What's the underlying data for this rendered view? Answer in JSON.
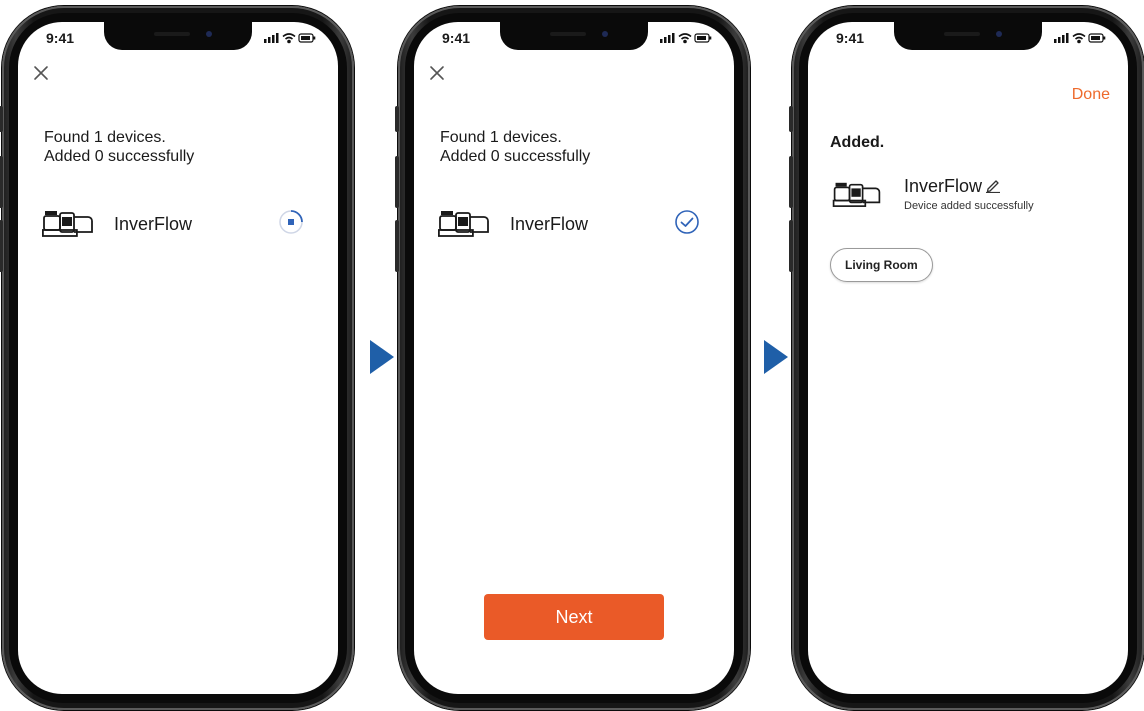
{
  "status_bar": {
    "time": "9:41"
  },
  "screen1": {
    "found_line1": "Found 1 devices.",
    "found_line2": "Added 0 successfully",
    "device_name": "InverFlow",
    "state": "adding"
  },
  "screen2": {
    "found_line1": "Found 1 devices.",
    "found_line2": "Added 0 successfully",
    "device_name": "InverFlow",
    "state": "added",
    "next_label": "Next"
  },
  "screen3": {
    "done_label": "Done",
    "added_title": "Added.",
    "device_name": "InverFlow",
    "device_status": "Device added successfully",
    "room_label": "Living Room"
  },
  "icons": [
    "close-icon",
    "pump-device-icon",
    "loading-spinner-icon",
    "check-circle-icon",
    "edit-pencil-icon",
    "signal-icon",
    "wifi-icon",
    "battery-icon",
    "next-arrow-icon"
  ],
  "colors": {
    "accent": "#ea5a28",
    "done_text": "#ee6a2c",
    "step_arrow": "#1f5fa8",
    "check": "#2f63b8"
  }
}
